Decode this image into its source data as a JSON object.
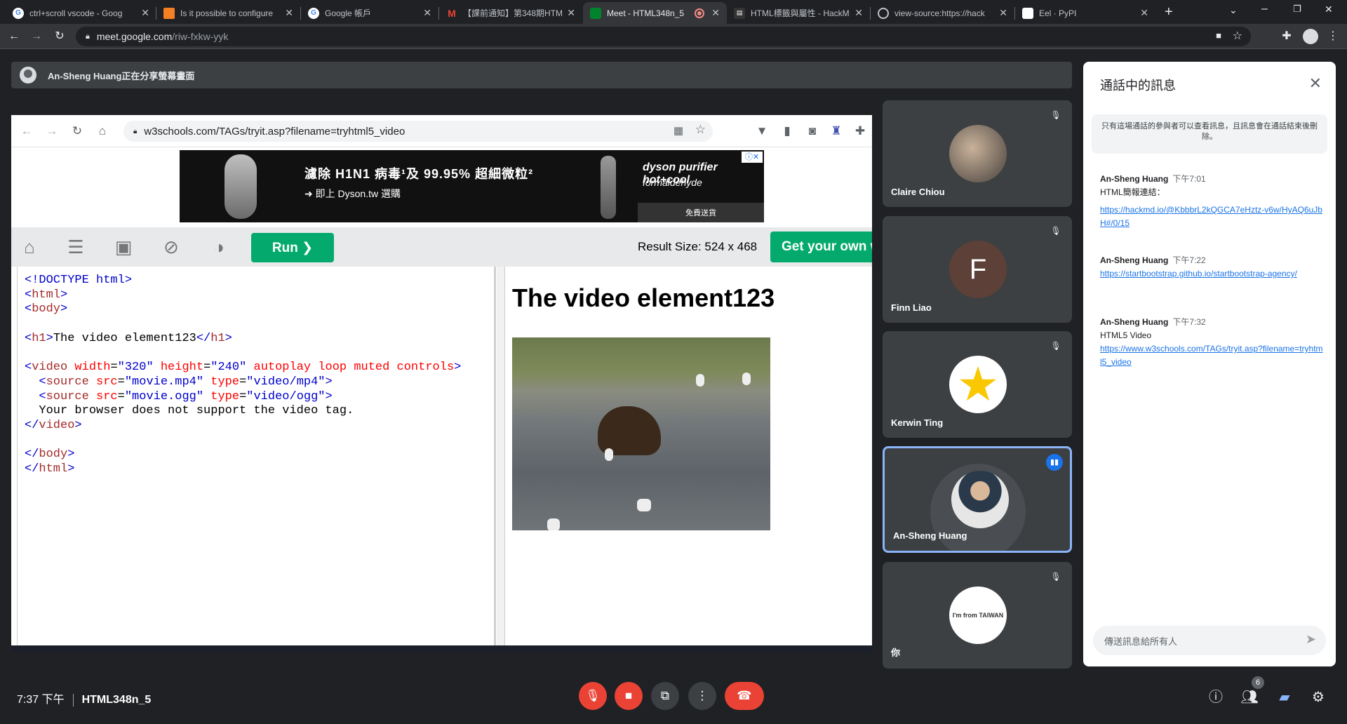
{
  "browser": {
    "tabs": [
      {
        "title": "ctrl+scroll vscode - Goog",
        "favicon": "google-icon"
      },
      {
        "title": "Is it possible to configure",
        "favicon": "stackoverflow-icon"
      },
      {
        "title": "Google 帳戶",
        "favicon": "google-icon"
      },
      {
        "title": "【課前通知】第348期HTM",
        "favicon": "gmail-icon"
      },
      {
        "title": "Meet - HTML348n_5",
        "favicon": "meet-icon",
        "active": true
      },
      {
        "title": "HTML標籤與屬性 - HackM",
        "favicon": "hackmd-icon"
      },
      {
        "title": "view-source:https://hack",
        "favicon": "globe-icon"
      },
      {
        "title": "Eel · PyPI",
        "favicon": "pypi-icon"
      }
    ],
    "url_host": "meet.google.com",
    "url_path": "/riw-fxkw-yyk"
  },
  "meet": {
    "presenting_text": "An-Sheng Huang正在分享螢幕畫面",
    "participants": [
      {
        "name": "Claire Chiou",
        "avatar": "photo",
        "muted": true
      },
      {
        "name": "Finn Liao",
        "avatar_letter": "F",
        "muted": true
      },
      {
        "name": "Kerwin Ting",
        "avatar": "star",
        "muted": true
      },
      {
        "name": "An-Sheng Huang",
        "avatar": "photo",
        "speaking": true
      },
      {
        "name": "你",
        "avatar": "cartoon",
        "muted": true
      }
    ],
    "meeting_time": "7:37 下午",
    "meeting_code": "HTML348n_5",
    "participant_count": "6"
  },
  "shared": {
    "url": "w3schools.com/TAGs/tryit.asp?filename=tryhtml5_video",
    "ad_line1": "濾除 H1N1 病毒¹及 99.95% 超細微粒²",
    "ad_line2": "➜ 即上 Dyson.tw 選購",
    "ad_brand": "dyson purifier hot+cool",
    "ad_brand2": "formaldehyde",
    "ad_cta": "免費送貨",
    "run_label": "Run ❯",
    "result_size": "Result Size: 524 x 468",
    "get_own": "Get your own w",
    "result_heading": "The video element123"
  },
  "chat": {
    "title": "通話中的訊息",
    "notice": "只有這場通話的參與者可以查看訊息，且訊息會在通話結束後刪除。",
    "messages": [
      {
        "sender": "An-Sheng Huang",
        "time": "下午7:01",
        "text": "HTML簡報連結：",
        "link": "https://hackmd.io/@KbbbrL2kQGCA7eHztz-v6w/HyAQ6uJbH#/0/15"
      },
      {
        "sender": "An-Sheng Huang",
        "time": "下午7:22",
        "text": "",
        "link": "https://startbootstrap.github.io/startbootstrap-agency/"
      },
      {
        "sender": "An-Sheng Huang",
        "time": "下午7:32",
        "text": "HTML5 Video",
        "link": "https://www.w3schools.com/TAGs/tryit.asp?filename=tryhtml5_video"
      }
    ],
    "input_placeholder": "傳送訊息給所有人"
  },
  "colors": {
    "accent": "#1a73e8",
    "danger": "#ea4335",
    "w3green": "#04aa6d"
  }
}
